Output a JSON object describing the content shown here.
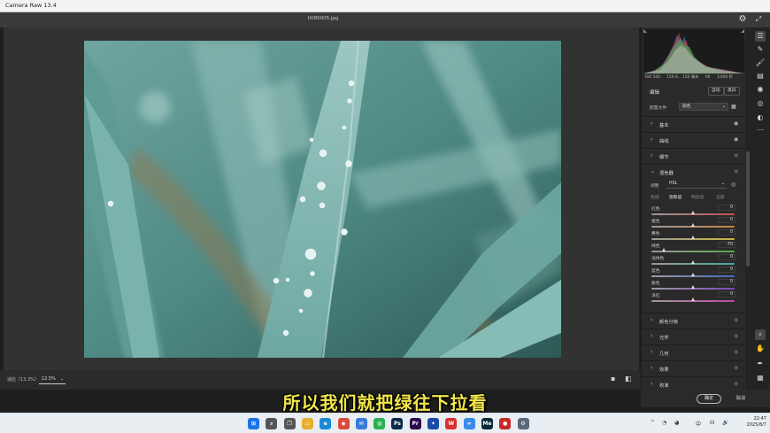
{
  "app": {
    "title": "Camera Raw 13.4",
    "filename": "IXI80005.jpg"
  },
  "bottom": {
    "zoom_label": "适应（13.3%）",
    "zoom_value": "12.5%",
    "status_line": ""
  },
  "histogram": {
    "exif": [
      "ISO 500",
      "150-6... 150 毫米",
      "f/6",
      "1/400 秒"
    ]
  },
  "edit": {
    "title": "编辑",
    "auto_label": "自动",
    "bw_label": "黑白",
    "profile_label": "配置文件",
    "profile_value": "颜色"
  },
  "sections": [
    {
      "title": "基本",
      "eye": "◉"
    },
    {
      "title": "曲线",
      "eye": "◉"
    },
    {
      "title": "细节",
      "eye": "◉"
    },
    {
      "title": "混色器",
      "eye": "◉"
    }
  ],
  "mixer": {
    "adjust_label": "调整",
    "adjust_value": "HSL",
    "tabs": [
      "色相",
      "饱和度",
      "明亮度",
      "全部"
    ],
    "active_tab": "饱和度",
    "sliders": [
      {
        "label": "红色",
        "value": "0",
        "fraction": 0.5,
        "track": "linear-gradient(90deg,#9a9a9a,#c05050)"
      },
      {
        "label": "橙色",
        "value": "0",
        "fraction": 0.5,
        "track": "linear-gradient(90deg,#9a9a9a,#c98040)"
      },
      {
        "label": "黄色",
        "value": "0",
        "fraction": 0.5,
        "track": "linear-gradient(90deg,#9a9a9a,#c9b640)"
      },
      {
        "label": "绿色",
        "value": "-70",
        "fraction": 0.15,
        "track": "linear-gradient(90deg,#9a9a9a,#5aa848)"
      },
      {
        "label": "浅绿色",
        "value": "0",
        "fraction": 0.5,
        "track": "linear-gradient(90deg,#9a9a9a,#48a8a0)"
      },
      {
        "label": "蓝色",
        "value": "0",
        "fraction": 0.5,
        "track": "linear-gradient(90deg,#9a9a9a,#4868c0)"
      },
      {
        "label": "紫色",
        "value": "0",
        "fraction": 0.5,
        "track": "linear-gradient(90deg,#9a9a9a,#8048c0)"
      },
      {
        "label": "洋红",
        "value": "0",
        "fraction": 0.5,
        "track": "linear-gradient(90deg,#9a9a9a,#c048a8)"
      }
    ]
  },
  "lower_sections": [
    {
      "title": "颜色分级"
    },
    {
      "title": "光学"
    },
    {
      "title": "几何"
    },
    {
      "title": "效果"
    },
    {
      "title": "校准"
    }
  ],
  "footer": {
    "ok_label": "确定",
    "cancel_label": "取消"
  },
  "subtitle": "所以我们就把绿往下拉看",
  "taskbar": {
    "apps": [
      {
        "name": "windows-start",
        "glyph": "⊞",
        "color": "#1a73e8"
      },
      {
        "name": "search",
        "glyph": "⌕",
        "color": "#555555"
      },
      {
        "name": "task-view",
        "glyph": "❐",
        "color": "#555555"
      },
      {
        "name": "file-explorer",
        "glyph": "▭",
        "color": "#e8b030"
      },
      {
        "name": "edge",
        "glyph": "e",
        "color": "#1a8ad8"
      },
      {
        "name": "chrome",
        "glyph": "◉",
        "color": "#d84a3a"
      },
      {
        "name": "mail",
        "glyph": "✉",
        "color": "#3a7ad8"
      },
      {
        "name": "wechat",
        "glyph": "◍",
        "color": "#2ab050"
      },
      {
        "name": "photoshop",
        "glyph": "Ps",
        "color": "#0a2a4a"
      },
      {
        "name": "premiere",
        "glyph": "Pr",
        "color": "#2a0a4a"
      },
      {
        "name": "app-blue",
        "glyph": "✦",
        "color": "#1a4aa8"
      },
      {
        "name": "app-wps",
        "glyph": "W",
        "color": "#d83030"
      },
      {
        "name": "app-cloud",
        "glyph": "∞",
        "color": "#3a8ae8"
      },
      {
        "name": "media-encoder",
        "glyph": "Me",
        "color": "#0a2a3a"
      },
      {
        "name": "recorder",
        "glyph": "●",
        "color": "#c82828"
      },
      {
        "name": "settings",
        "glyph": "⚙",
        "color": "#5a6a7a"
      }
    ],
    "tray": [
      "^",
      "◔",
      "◕",
      "中",
      "☊",
      "🔊"
    ],
    "time": "22:47",
    "date": "2025/8/7"
  }
}
